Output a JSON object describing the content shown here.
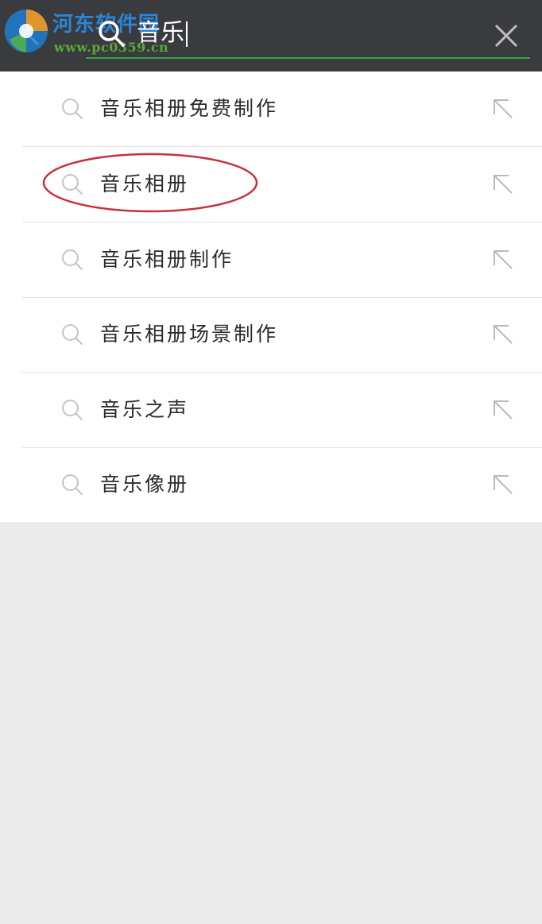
{
  "header": {
    "search_value": "音乐",
    "icons": {
      "back": "back-arrow-icon",
      "search": "search-icon",
      "clear": "close-icon"
    },
    "colors": {
      "bar": "#3a3b3f",
      "underline": "#2aa845"
    }
  },
  "watermark": {
    "title": "河东软件园",
    "url": "www.pc0359.cn"
  },
  "suggestions": [
    {
      "label": "音乐相册免费制作"
    },
    {
      "label": "音乐相册"
    },
    {
      "label": "音乐相册制作"
    },
    {
      "label": "音乐相册场景制作"
    },
    {
      "label": "音乐之声"
    },
    {
      "label": "音乐像册"
    }
  ],
  "annotation": {
    "highlighted_item": "音乐相册",
    "color": "#c8323a"
  }
}
